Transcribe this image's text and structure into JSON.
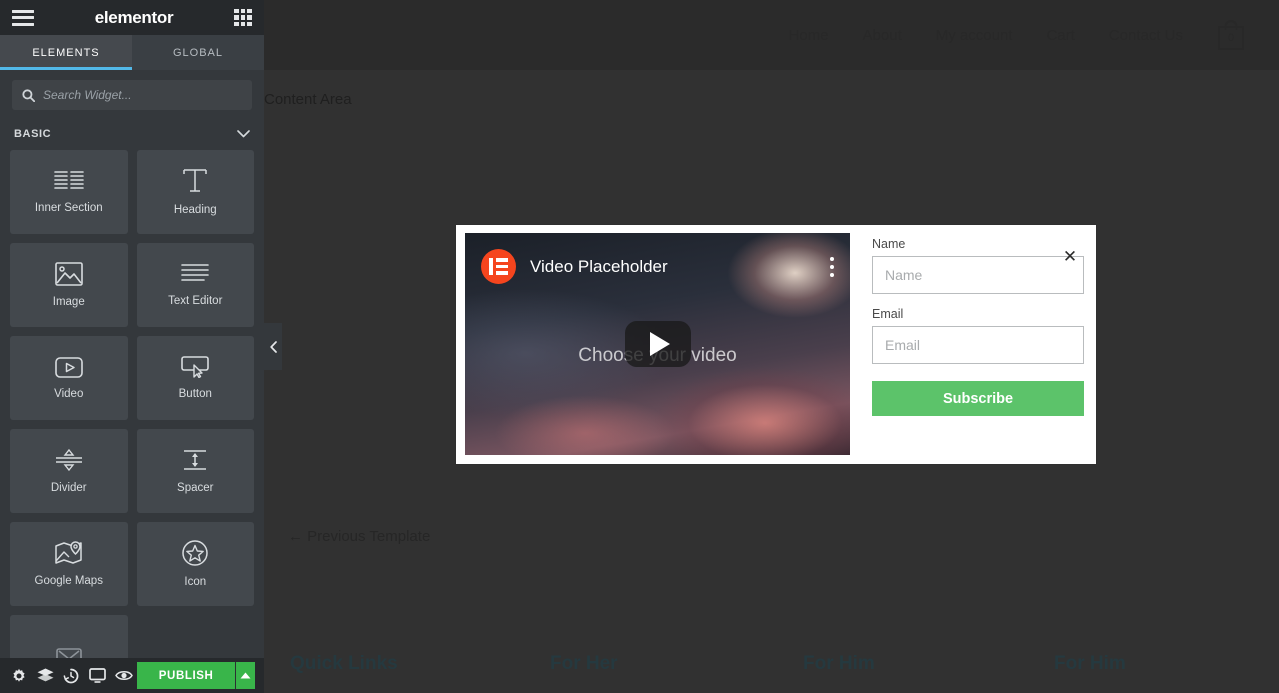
{
  "panel": {
    "brand": "elementor",
    "menu_icon": "hamburger-icon",
    "apps_icon": "grid-icon",
    "tabs": [
      {
        "label": "ELEMENTS",
        "active": true
      },
      {
        "label": "GLOBAL",
        "active": false
      }
    ],
    "search": {
      "value": "",
      "placeholder": "Search Widget..."
    },
    "section": {
      "label": "BASIC",
      "chevron": "chevron-down-icon"
    },
    "widgets": [
      {
        "label": "Inner Section",
        "icon": "inner-section-icon"
      },
      {
        "label": "Heading",
        "icon": "heading-icon"
      },
      {
        "label": "Image",
        "icon": "image-icon"
      },
      {
        "label": "Text Editor",
        "icon": "text-editor-icon"
      },
      {
        "label": "Video",
        "icon": "video-icon"
      },
      {
        "label": "Button",
        "icon": "button-icon"
      },
      {
        "label": "Divider",
        "icon": "divider-icon"
      },
      {
        "label": "Spacer",
        "icon": "spacer-icon"
      },
      {
        "label": "Google Maps",
        "icon": "google-maps-icon"
      },
      {
        "label": "Icon",
        "icon": "star-icon"
      }
    ],
    "footer": {
      "icons": [
        "settings-gear-icon",
        "navigator-layers-icon",
        "history-clock-icon",
        "responsive-monitor-icon",
        "preview-eye-icon"
      ],
      "publish_label": "PUBLISH",
      "publish_caret": "caret-up-icon",
      "publish_color": "#39b54a"
    },
    "collapse_handle": "chevron-left-icon"
  },
  "canvas": {
    "nav": [
      {
        "label": "Home"
      },
      {
        "label": "About"
      },
      {
        "label": "My account"
      },
      {
        "label": "Cart"
      },
      {
        "label": "Contact Us"
      }
    ],
    "cart": {
      "icon": "shopping-bag-icon",
      "count": "0"
    },
    "content_area_label": "Content Area",
    "previous_template": "← Previous Template",
    "footer_columns": [
      {
        "label": "Quick Links"
      },
      {
        "label": "For Her"
      },
      {
        "label": "For Him"
      },
      {
        "label": "For Him"
      }
    ]
  },
  "modal": {
    "close_icon": "close-x-icon",
    "video": {
      "logo_icon": "elementor-logo-icon",
      "title": "Video Placeholder",
      "menu_icon": "kebab-menu-icon",
      "overlay_text": "Choose your video",
      "play_icon": "play-button-icon",
      "logo_color": "#f5451e"
    },
    "form": {
      "name": {
        "label": "Name",
        "value": "",
        "placeholder": "Name"
      },
      "email": {
        "label": "Email",
        "value": "",
        "placeholder": "Email"
      },
      "submit": {
        "label": "Subscribe",
        "color": "#5cc36a"
      }
    }
  }
}
